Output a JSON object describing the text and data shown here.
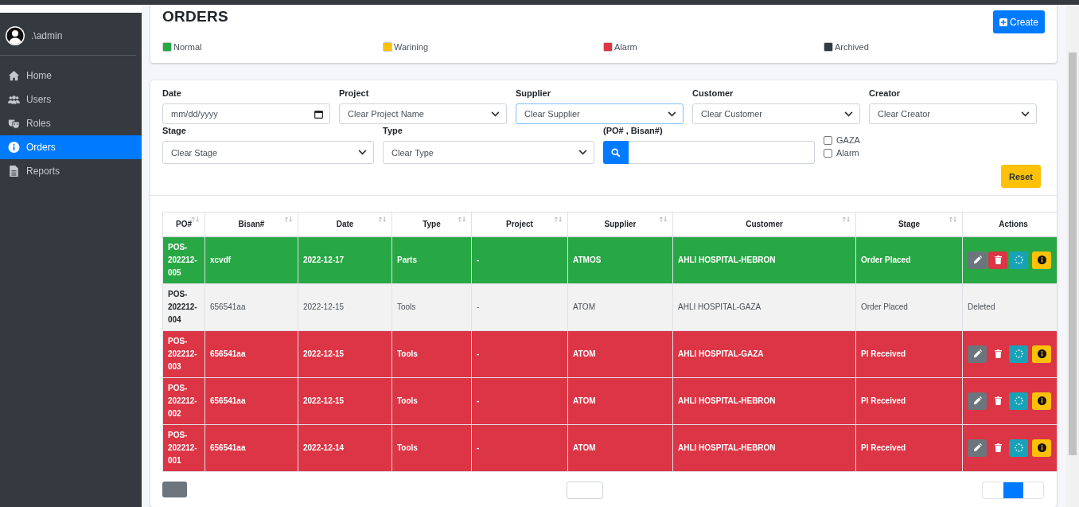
{
  "sidebar": {
    "user": ".\\admin",
    "items": [
      {
        "label": "Home",
        "selected": false
      },
      {
        "label": "Users",
        "selected": false
      },
      {
        "label": "Roles",
        "selected": false
      },
      {
        "label": "Orders",
        "selected": true
      },
      {
        "label": "Reports",
        "selected": false
      }
    ]
  },
  "header": {
    "title": "ORDERS",
    "create_button": "Create",
    "legend": [
      {
        "label": "Normal",
        "color": "#28a745"
      },
      {
        "label": "Warining",
        "color": "#ffc107"
      },
      {
        "label": "Alarm",
        "color": "#dc3545"
      },
      {
        "label": "Archived",
        "color": "#343a40"
      }
    ]
  },
  "filters": {
    "row_1": [
      {
        "label": "Date",
        "kind": "date",
        "placeholder": "mm/dd/yyyy"
      },
      {
        "label": "Project",
        "kind": "select",
        "value": "Clear Project Name",
        "focused": false
      },
      {
        "label": "Supplier",
        "kind": "select",
        "value": "Clear Supplier",
        "focused": true
      },
      {
        "label": "Customer",
        "kind": "select",
        "value": "Clear Customer",
        "focused": false
      },
      {
        "label": "Creator",
        "kind": "select",
        "value": "Clear Creator",
        "focused": false
      }
    ],
    "row_2": [
      {
        "label": "Stage",
        "kind": "select",
        "value": "Clear Stage",
        "focused": false
      },
      {
        "label": "Type",
        "kind": "select",
        "value": "Clear Type",
        "focused": false
      }
    ],
    "search_label": "(PO# , Bisan#)",
    "checkboxes": [
      {
        "label": "GAZA",
        "checked": false
      },
      {
        "label": "Alarm",
        "checked": false
      }
    ],
    "reset_button": "Reset"
  },
  "table": {
    "columns": [
      {
        "label": "PO#",
        "sortable": true
      },
      {
        "label": "Bisan#",
        "sortable": true
      },
      {
        "label": "Date",
        "sortable": true
      },
      {
        "label": "Type",
        "sortable": true
      },
      {
        "label": "Project",
        "sortable": true
      },
      {
        "label": "Supplier",
        "sortable": true
      },
      {
        "label": "Customer",
        "sortable": true
      },
      {
        "label": "Stage",
        "sortable": true
      },
      {
        "label": "Actions",
        "sortable": false
      }
    ],
    "rows": [
      {
        "color": "#28a745",
        "cells": [
          "POS-202212-005",
          "xcvdf",
          "2022-12-17",
          "Parts",
          "-",
          "ATMOS",
          "AHLI HOSPITAL-HEBRON",
          "Order Placed"
        ]
      },
      {
        "color": "#f2f2f2",
        "cells": [
          "POS-202212-004",
          "656541aa",
          "2022-12-15",
          "Tools",
          "-",
          "ATOM",
          "AHLI HOSPITAL-GAZA",
          "Order Placed"
        ],
        "actions_text": "Deleted"
      },
      {
        "color": "#dc3545",
        "cells": [
          "POS-202212-003",
          "656541aa",
          "2022-12-15",
          "Tools",
          "-",
          "ATOM",
          "AHLI HOSPITAL-GAZA",
          "PI Received"
        ]
      },
      {
        "color": "#dc3545",
        "cells": [
          "POS-202212-002",
          "656541aa",
          "2022-12-15",
          "Tools",
          "-",
          "ATOM",
          "AHLI HOSPITAL-HEBRON",
          "PI Received"
        ]
      },
      {
        "color": "#dc3545",
        "cells": [
          "POS-202212-001",
          "656541aa",
          "2022-12-14",
          "Tools",
          "-",
          "ATOM",
          "AHLI HOSPITAL-HEBRON",
          "PI Received"
        ]
      }
    ]
  }
}
